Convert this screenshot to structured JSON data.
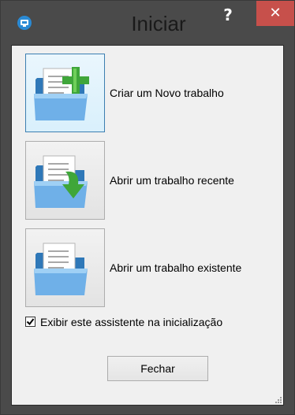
{
  "window": {
    "title": "Iniciar",
    "help_label": "?",
    "close_label": "✕",
    "colors": {
      "frame": "#4a4a4a",
      "close": "#c7504b",
      "panel": "#f0f0f0",
      "active_border": "#3c7fb1"
    }
  },
  "actions": [
    {
      "label": "Criar um Novo trabalho",
      "icon": "new-document-folder-icon"
    },
    {
      "label": "Abrir um trabalho recente",
      "icon": "recent-document-folder-icon"
    },
    {
      "label": "Abrir um trabalho existente",
      "icon": "open-document-folder-icon"
    }
  ],
  "startup_checkbox": {
    "label": "Exibir este assistente na inicialização",
    "checked": true
  },
  "footer": {
    "close_button": "Fechar"
  }
}
